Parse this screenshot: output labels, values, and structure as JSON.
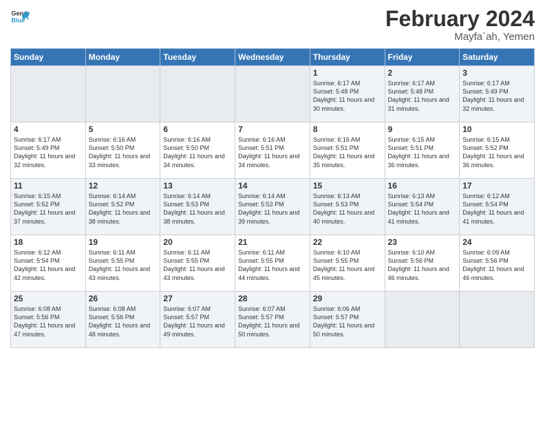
{
  "logo": {
    "line1": "General",
    "line2": "Blue"
  },
  "title": "February 2024",
  "location": "Mayfa`ah, Yemen",
  "days_header": [
    "Sunday",
    "Monday",
    "Tuesday",
    "Wednesday",
    "Thursday",
    "Friday",
    "Saturday"
  ],
  "weeks": [
    [
      {
        "day": "",
        "empty": true
      },
      {
        "day": "",
        "empty": true
      },
      {
        "day": "",
        "empty": true
      },
      {
        "day": "",
        "empty": true
      },
      {
        "day": "1",
        "sunrise": "6:17 AM",
        "sunset": "5:48 PM",
        "daylight": "11 hours and 30 minutes."
      },
      {
        "day": "2",
        "sunrise": "6:17 AM",
        "sunset": "5:48 PM",
        "daylight": "11 hours and 31 minutes."
      },
      {
        "day": "3",
        "sunrise": "6:17 AM",
        "sunset": "5:49 PM",
        "daylight": "11 hours and 32 minutes."
      }
    ],
    [
      {
        "day": "4",
        "sunrise": "6:17 AM",
        "sunset": "5:49 PM",
        "daylight": "11 hours and 32 minutes."
      },
      {
        "day": "5",
        "sunrise": "6:16 AM",
        "sunset": "5:50 PM",
        "daylight": "11 hours and 33 minutes."
      },
      {
        "day": "6",
        "sunrise": "6:16 AM",
        "sunset": "5:50 PM",
        "daylight": "11 hours and 34 minutes."
      },
      {
        "day": "7",
        "sunrise": "6:16 AM",
        "sunset": "5:51 PM",
        "daylight": "11 hours and 34 minutes."
      },
      {
        "day": "8",
        "sunrise": "6:16 AM",
        "sunset": "5:51 PM",
        "daylight": "11 hours and 35 minutes."
      },
      {
        "day": "9",
        "sunrise": "6:15 AM",
        "sunset": "5:51 PM",
        "daylight": "11 hours and 36 minutes."
      },
      {
        "day": "10",
        "sunrise": "6:15 AM",
        "sunset": "5:52 PM",
        "daylight": "11 hours and 36 minutes."
      }
    ],
    [
      {
        "day": "11",
        "sunrise": "6:15 AM",
        "sunset": "5:52 PM",
        "daylight": "11 hours and 37 minutes."
      },
      {
        "day": "12",
        "sunrise": "6:14 AM",
        "sunset": "5:52 PM",
        "daylight": "11 hours and 38 minutes."
      },
      {
        "day": "13",
        "sunrise": "6:14 AM",
        "sunset": "5:53 PM",
        "daylight": "11 hours and 38 minutes."
      },
      {
        "day": "14",
        "sunrise": "6:14 AM",
        "sunset": "5:53 PM",
        "daylight": "11 hours and 39 minutes."
      },
      {
        "day": "15",
        "sunrise": "6:13 AM",
        "sunset": "5:53 PM",
        "daylight": "11 hours and 40 minutes."
      },
      {
        "day": "16",
        "sunrise": "6:13 AM",
        "sunset": "5:54 PM",
        "daylight": "11 hours and 41 minutes."
      },
      {
        "day": "17",
        "sunrise": "6:12 AM",
        "sunset": "5:54 PM",
        "daylight": "11 hours and 41 minutes."
      }
    ],
    [
      {
        "day": "18",
        "sunrise": "6:12 AM",
        "sunset": "5:54 PM",
        "daylight": "11 hours and 42 minutes."
      },
      {
        "day": "19",
        "sunrise": "6:11 AM",
        "sunset": "5:55 PM",
        "daylight": "11 hours and 43 minutes."
      },
      {
        "day": "20",
        "sunrise": "6:11 AM",
        "sunset": "5:55 PM",
        "daylight": "11 hours and 43 minutes."
      },
      {
        "day": "21",
        "sunrise": "6:11 AM",
        "sunset": "5:55 PM",
        "daylight": "11 hours and 44 minutes."
      },
      {
        "day": "22",
        "sunrise": "6:10 AM",
        "sunset": "5:55 PM",
        "daylight": "11 hours and 45 minutes."
      },
      {
        "day": "23",
        "sunrise": "6:10 AM",
        "sunset": "5:56 PM",
        "daylight": "11 hours and 46 minutes."
      },
      {
        "day": "24",
        "sunrise": "6:09 AM",
        "sunset": "5:56 PM",
        "daylight": "11 hours and 46 minutes."
      }
    ],
    [
      {
        "day": "25",
        "sunrise": "6:08 AM",
        "sunset": "5:56 PM",
        "daylight": "11 hours and 47 minutes."
      },
      {
        "day": "26",
        "sunrise": "6:08 AM",
        "sunset": "5:56 PM",
        "daylight": "11 hours and 48 minutes."
      },
      {
        "day": "27",
        "sunrise": "6:07 AM",
        "sunset": "5:57 PM",
        "daylight": "11 hours and 49 minutes."
      },
      {
        "day": "28",
        "sunrise": "6:07 AM",
        "sunset": "5:57 PM",
        "daylight": "11 hours and 50 minutes."
      },
      {
        "day": "29",
        "sunrise": "6:06 AM",
        "sunset": "5:57 PM",
        "daylight": "11 hours and 50 minutes."
      },
      {
        "day": "",
        "empty": true
      },
      {
        "day": "",
        "empty": true
      }
    ]
  ]
}
